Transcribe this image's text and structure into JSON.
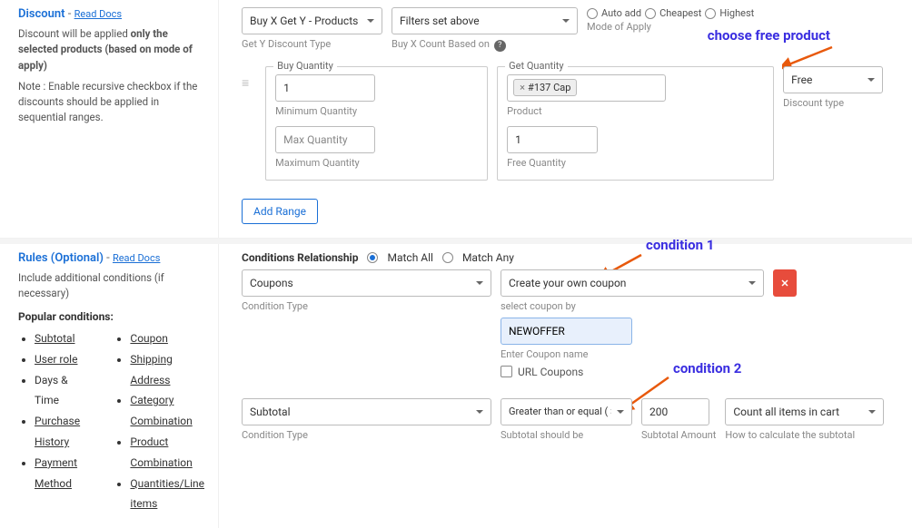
{
  "discount": {
    "title": "Discount",
    "dash": " - ",
    "readDocs": "Read Docs",
    "desc1a": "Discount will be applied ",
    "desc1b": "only the selected products (based on mode of apply)",
    "note": "Note : Enable recursive checkbox if the discounts should be applied in sequential ranges.",
    "getYType": {
      "value": "Buy X Get Y - Products",
      "label": "Get Y Discount Type"
    },
    "buyXCount": {
      "value": "Filters set above",
      "label": "Buy X Count Based on"
    },
    "modeApplyLabel": "Mode of Apply",
    "modes": {
      "auto": "Auto add",
      "cheap": "Cheapest",
      "high": "Highest"
    },
    "buyQty": {
      "legend": "Buy Quantity",
      "min": "1",
      "minLbl": "Minimum Quantity",
      "maxPh": "Max Quantity",
      "maxLbl": "Maximum Quantity"
    },
    "getQty": {
      "legend": "Get Quantity",
      "chip": "#137 Cap",
      "prodLbl": "Product",
      "qty": "1",
      "qtyLbl": "Free Quantity"
    },
    "discType": {
      "value": "Free",
      "label": "Discount type"
    },
    "addRange": "Add Range",
    "annot": "choose free product"
  },
  "rules": {
    "title": "Rules (Optional)",
    "dash": " - ",
    "readDocs": "Read Docs",
    "desc": "Include additional conditions (if necessary)",
    "popular": "Popular conditions:",
    "col1": [
      "Subtotal",
      "User role",
      "Days & Time",
      "Purchase History",
      "Payment Method"
    ],
    "col2": [
      "Coupon",
      "Shipping Address",
      "Category Combination",
      "Product Combination",
      "Quantities/Line items"
    ],
    "condRelLabel": "Conditions Relationship",
    "matchAll": "Match All",
    "matchAny": "Match Any",
    "c1": {
      "type": "Coupons",
      "typeLbl": "Condition Type",
      "mode": "Create your own coupon",
      "modeLbl": "select coupon by",
      "couponVal": "NEWOFFER",
      "couponLbl": "Enter Coupon name",
      "urlCoup": "URL Coupons"
    },
    "c2": {
      "type": "Subtotal",
      "typeLbl": "Condition Type",
      "op": "Greater than or equal ( >= )",
      "opLbl": "Subtotal should be",
      "amt": "200",
      "amtLbl": "Subtotal Amount",
      "calc": "Count all items in cart",
      "calcLbl": "How to calculate the subtotal"
    },
    "annot1": "condition 1",
    "annot2": "condition 2"
  }
}
